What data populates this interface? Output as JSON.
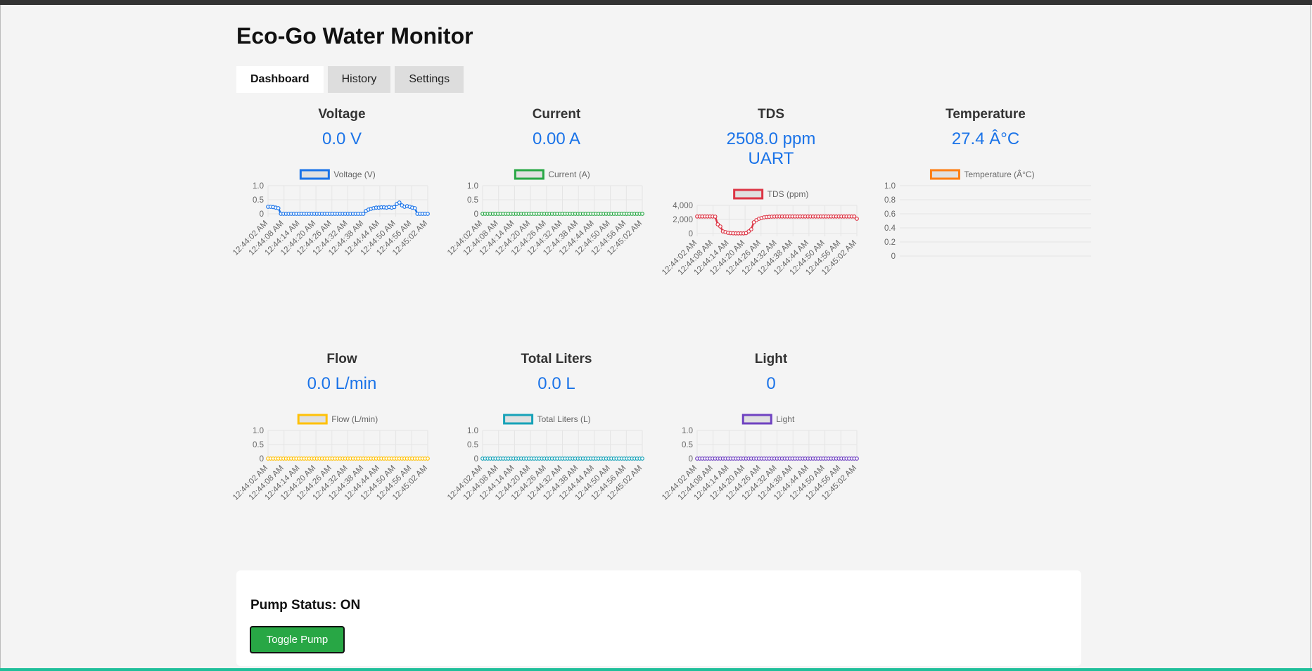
{
  "app": {
    "title": "Eco-Go Water Monitor"
  },
  "tabs": [
    {
      "label": "Dashboard",
      "active": true
    },
    {
      "label": "History",
      "active": false
    },
    {
      "label": "Settings",
      "active": false
    }
  ],
  "cards": [
    {
      "key": "voltage",
      "label": "Voltage",
      "value": "0.0 V",
      "sub": ""
    },
    {
      "key": "current",
      "label": "Current",
      "value": "0.00 A",
      "sub": ""
    },
    {
      "key": "tds",
      "label": "TDS",
      "value": "2508.0 ppm",
      "sub": "UART"
    },
    {
      "key": "temperature",
      "label": "Temperature",
      "value": "27.4 Â°C",
      "sub": ""
    },
    {
      "key": "flow",
      "label": "Flow",
      "value": "0.0 L/min",
      "sub": ""
    },
    {
      "key": "total-liters",
      "label": "Total Liters",
      "value": "0.0 L",
      "sub": ""
    },
    {
      "key": "light",
      "label": "Light",
      "value": "0",
      "sub": ""
    }
  ],
  "pump": {
    "status_label": "Pump Status: ON",
    "toggle_label": "Toggle Pump"
  },
  "chart_data": [
    {
      "type": "line",
      "name": "voltage",
      "legend": "Voltage (V)",
      "color": "#1a73e8",
      "x_ticks": [
        "12:44:02 AM",
        "12:44:08 AM",
        "12:44:14 AM",
        "12:44:20 AM",
        "12:44:26 AM",
        "12:44:32 AM",
        "12:44:38 AM",
        "12:44:44 AM",
        "12:44:50 AM",
        "12:44:56 AM",
        "12:45:02 AM"
      ],
      "y_ticks": [
        "1.0",
        "0.5",
        "0"
      ],
      "ylim": [
        0,
        1
      ],
      "values": [
        0.25,
        0.25,
        0.24,
        0.22,
        0.2,
        0,
        0,
        0,
        0,
        0,
        0,
        0,
        0,
        0,
        0,
        0,
        0,
        0,
        0,
        0,
        0,
        0,
        0,
        0,
        0,
        0,
        0,
        0,
        0,
        0,
        0,
        0,
        0,
        0,
        0,
        0,
        0,
        0,
        0.1,
        0.15,
        0.18,
        0.2,
        0.22,
        0.22,
        0.23,
        0.23,
        0.22,
        0.24,
        0.22,
        0.24,
        0.35,
        0.4,
        0.3,
        0.25,
        0.27,
        0.25,
        0.22,
        0.2,
        0,
        0,
        0,
        0,
        0
      ]
    },
    {
      "type": "line",
      "name": "current",
      "legend": "Current (A)",
      "color": "#28a745",
      "x_ticks": [
        "12:44:02 AM",
        "12:44:08 AM",
        "12:44:14 AM",
        "12:44:20 AM",
        "12:44:26 AM",
        "12:44:32 AM",
        "12:44:38 AM",
        "12:44:44 AM",
        "12:44:50 AM",
        "12:44:56 AM",
        "12:45:02 AM"
      ],
      "y_ticks": [
        "1.0",
        "0.5",
        "0"
      ],
      "ylim": [
        0,
        1
      ],
      "values": "zeros"
    },
    {
      "type": "line",
      "name": "tds",
      "legend": "TDS (ppm)",
      "color": "#dc3545",
      "x_ticks": [
        "12:44:02 AM",
        "12:44:08 AM",
        "12:44:14 AM",
        "12:44:20 AM",
        "12:44:26 AM",
        "12:44:32 AM",
        "12:44:38 AM",
        "12:44:44 AM",
        "12:44:50 AM",
        "12:44:56 AM",
        "12:45:02 AM"
      ],
      "y_ticks": [
        "4,000",
        "2,000",
        "0"
      ],
      "ylim": [
        0,
        4000
      ],
      "values": [
        2420,
        2420,
        2420,
        2420,
        2420,
        2420,
        2420,
        2400,
        1300,
        1000,
        300,
        200,
        100,
        50,
        30,
        20,
        20,
        20,
        20,
        50,
        300,
        600,
        1600,
        1900,
        2100,
        2200,
        2300,
        2350,
        2380,
        2400,
        2410,
        2420,
        2420,
        2420,
        2420,
        2420,
        2420,
        2420,
        2420,
        2420,
        2420,
        2420,
        2420,
        2420,
        2420,
        2420,
        2420,
        2420,
        2420,
        2420,
        2420,
        2420,
        2420,
        2420,
        2420,
        2420,
        2420,
        2420,
        2420,
        2420,
        2420,
        2420,
        2100
      ]
    },
    {
      "type": "line",
      "name": "temperature",
      "legend": "Temperature (Â°C)",
      "color": "#fd7e14",
      "x_ticks": [],
      "y_ticks": [
        "1.0",
        "0.8",
        "0.6",
        "0.4",
        "0.2",
        "0"
      ],
      "ylim": [
        0,
        1
      ],
      "values": []
    },
    {
      "type": "line",
      "name": "flow",
      "legend": "Flow (L/min)",
      "color": "#ffc107",
      "x_ticks": [
        "12:44:02 AM",
        "12:44:08 AM",
        "12:44:14 AM",
        "12:44:20 AM",
        "12:44:26 AM",
        "12:44:32 AM",
        "12:44:38 AM",
        "12:44:44 AM",
        "12:44:50 AM",
        "12:44:56 AM",
        "12:45:02 AM"
      ],
      "y_ticks": [
        "1.0",
        "0.5",
        "0"
      ],
      "ylim": [
        0,
        1
      ],
      "values": "zeros"
    },
    {
      "type": "line",
      "name": "total-liters",
      "legend": "Total Liters (L)",
      "color": "#17a2b8",
      "x_ticks": [
        "12:44:02 AM",
        "12:44:08 AM",
        "12:44:14 AM",
        "12:44:20 AM",
        "12:44:26 AM",
        "12:44:32 AM",
        "12:44:38 AM",
        "12:44:44 AM",
        "12:44:50 AM",
        "12:44:56 AM",
        "12:45:02 AM"
      ],
      "y_ticks": [
        "1.0",
        "0.5",
        "0"
      ],
      "ylim": [
        0,
        1
      ],
      "values": "zeros"
    },
    {
      "type": "line",
      "name": "light",
      "legend": "Light",
      "color": "#6f42c1",
      "x_ticks": [
        "12:44:02 AM",
        "12:44:08 AM",
        "12:44:14 AM",
        "12:44:20 AM",
        "12:44:26 AM",
        "12:44:32 AM",
        "12:44:38 AM",
        "12:44:44 AM",
        "12:44:50 AM",
        "12:44:56 AM",
        "12:45:02 AM"
      ],
      "y_ticks": [
        "1.0",
        "0.5",
        "0"
      ],
      "ylim": [
        0,
        1
      ],
      "values": "zeros"
    }
  ]
}
